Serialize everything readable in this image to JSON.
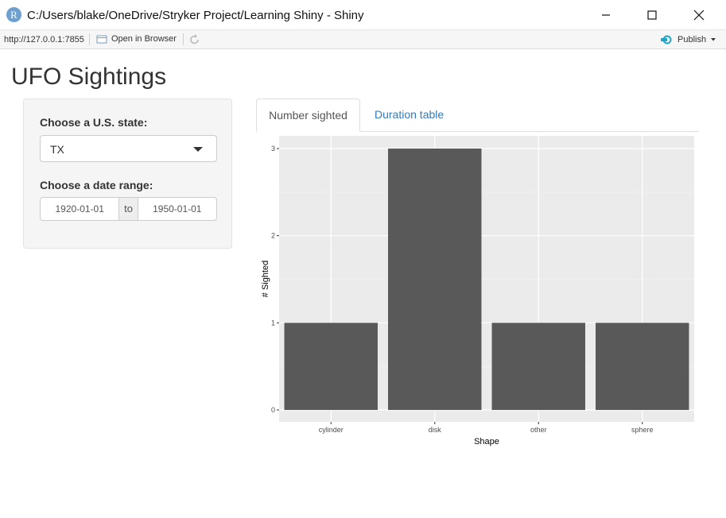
{
  "window": {
    "title": "C:/Users/blake/OneDrive/Stryker Project/Learning Shiny - Shiny",
    "logo_letter": "R"
  },
  "toolbar": {
    "url": "http://127.0.0.1:7855",
    "open_in_browser": "Open in Browser",
    "publish": "Publish",
    "accent_color": "#1fa3c9"
  },
  "app": {
    "title": "UFO Sightings",
    "state_label": "Choose a U.S. state:",
    "state_value": "TX",
    "date_label": "Choose a date range:",
    "date_start": "1920-01-01",
    "date_sep": "to",
    "date_end": "1950-01-01",
    "tabs": [
      {
        "label": "Number sighted",
        "active": true
      },
      {
        "label": "Duration table",
        "active": false
      }
    ]
  },
  "chart_data": {
    "type": "bar",
    "categories": [
      "cylinder",
      "disk",
      "other",
      "sphere"
    ],
    "values": [
      1,
      3,
      1,
      1
    ],
    "xlabel": "Shape",
    "ylabel": "# Sighted",
    "ylim": [
      0,
      3
    ],
    "yticks": [
      0,
      1,
      2,
      3
    ],
    "grid": true,
    "bar_color": "#595959",
    "panel_color": "#ebebeb"
  }
}
